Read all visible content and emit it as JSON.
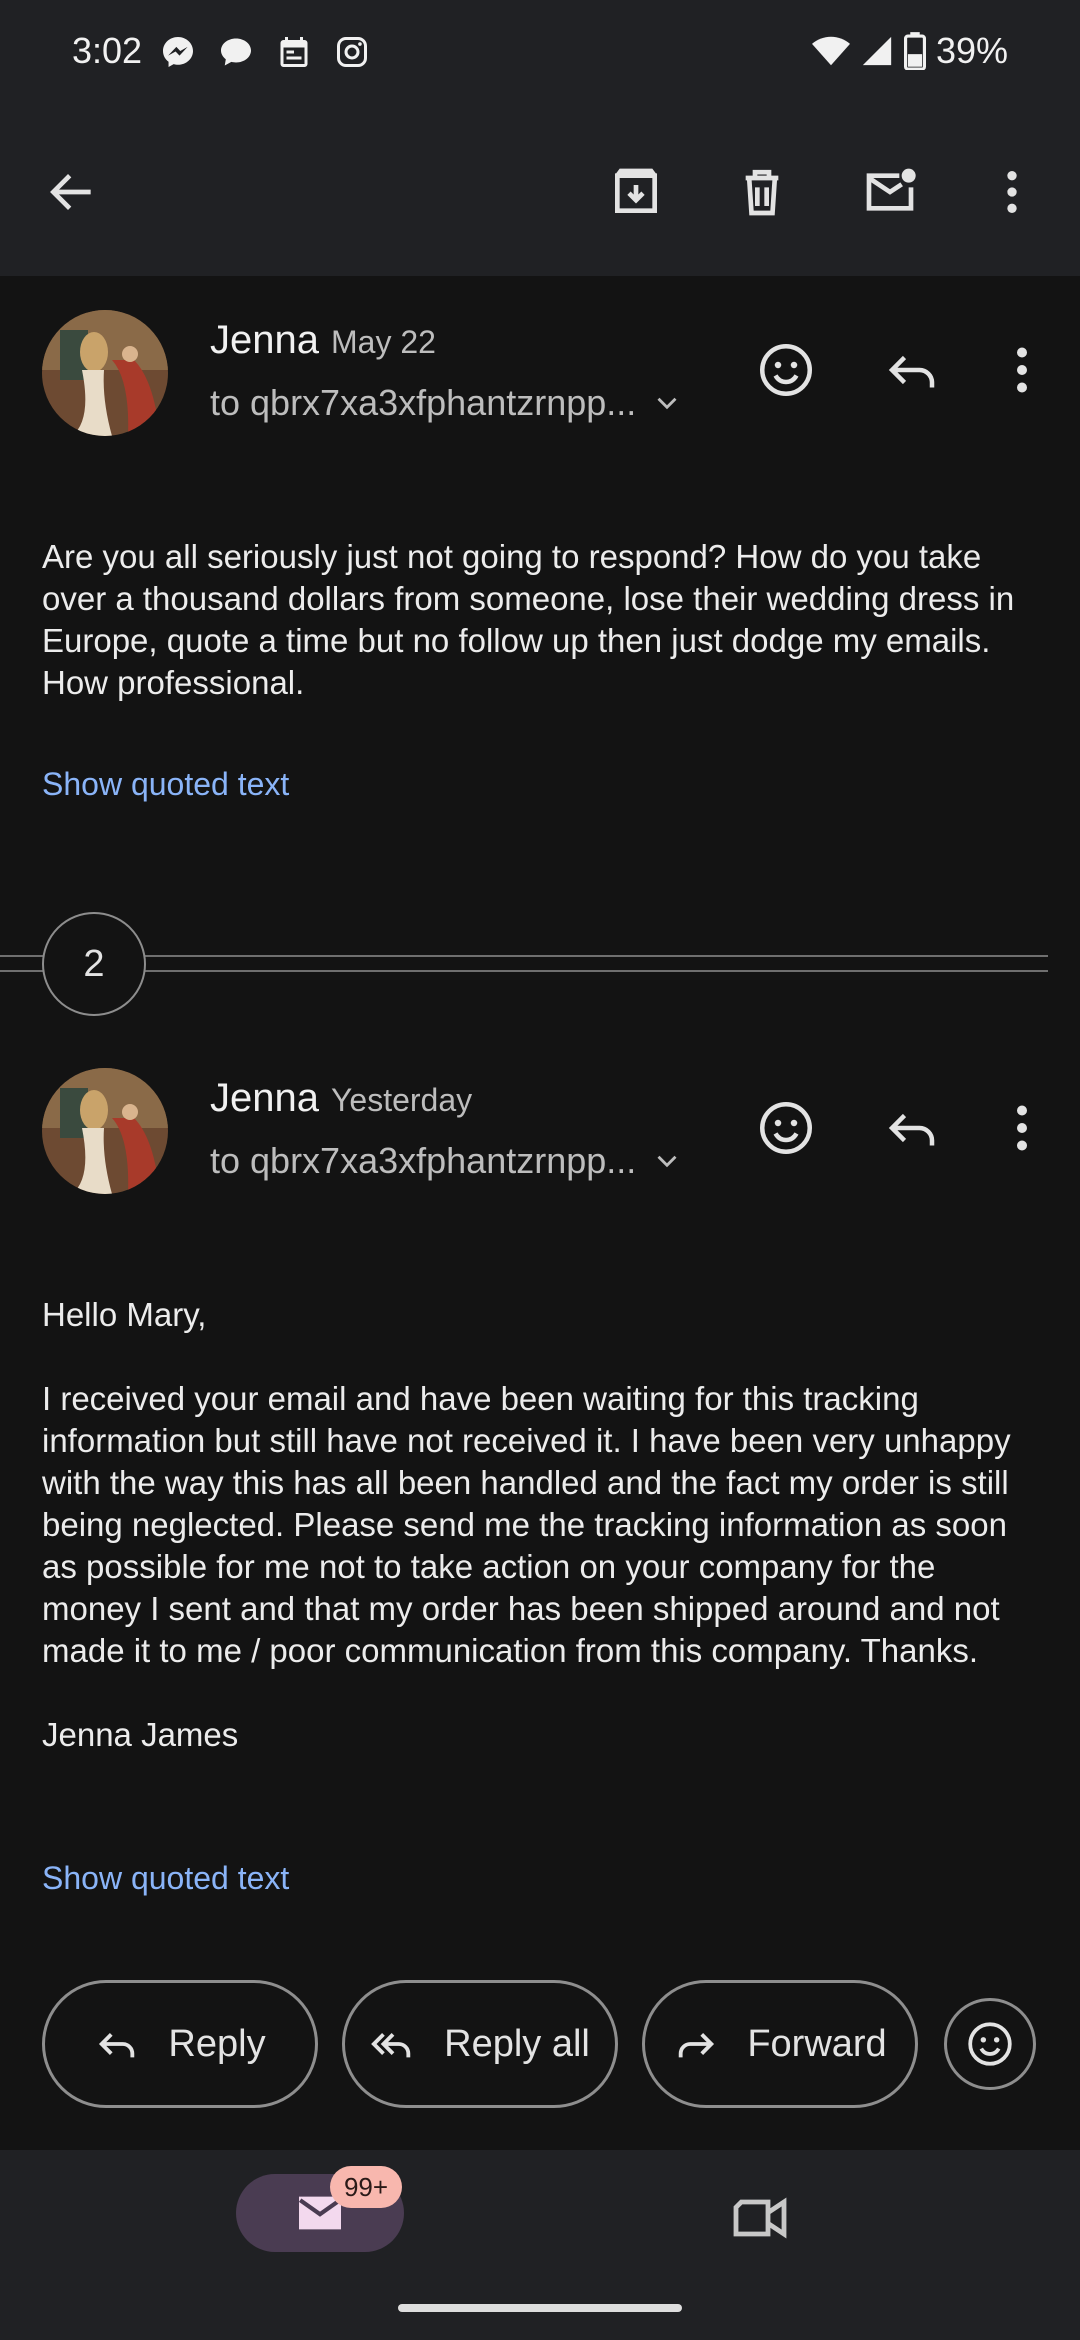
{
  "status_bar": {
    "time": "3:02",
    "battery": "39%",
    "left_icons": [
      "messenger-icon",
      "chat-bubble-icon",
      "calendar-icon",
      "instagram-icon"
    ],
    "right_icons": [
      "wifi-icon",
      "cell-signal-icon",
      "battery-icon"
    ]
  },
  "toolbar": {
    "icons": [
      "back-arrow-icon",
      "archive-icon",
      "delete-icon",
      "mark-unread-icon",
      "more-vert-icon"
    ]
  },
  "messages": [
    {
      "sender": "Jenna",
      "date": "May 22",
      "recipient": "to qbrx7xa3xfphantzrnpp...",
      "body": "Are you all seriously just not going to respond? How do you take over a thousand dollars from someone, lose their wedding dress in Europe, quote a time but no follow up then just dodge my emails. How professional.",
      "quoted_link": "Show quoted text"
    },
    {
      "sender": "Jenna",
      "date": "Yesterday",
      "recipient": "to qbrx7xa3xfphantzrnpp...",
      "body": "Hello Mary,\n\nI received your email and have been waiting for this tracking information but still have not received it. I have been very unhappy with the way this has all been handled and the fact my order is still being neglected. Please send me the tracking information as soon as possible for me not to take action on your company for the money I sent and that my order has been shipped around and not made it to me / poor communication from this company. Thanks.\n\nJenna James",
      "quoted_link": "Show quoted text"
    }
  ],
  "collapsed_count": "2",
  "actions": {
    "reply": "Reply",
    "reply_all": "Reply all",
    "forward": "Forward"
  },
  "bottom_nav": {
    "mail_badge": "99+"
  },
  "colors": {
    "background": "#131313",
    "bar": "#202124",
    "link": "#8ab4f8",
    "badge": "#f8b7ae",
    "active_pill": "#4a3c52"
  }
}
